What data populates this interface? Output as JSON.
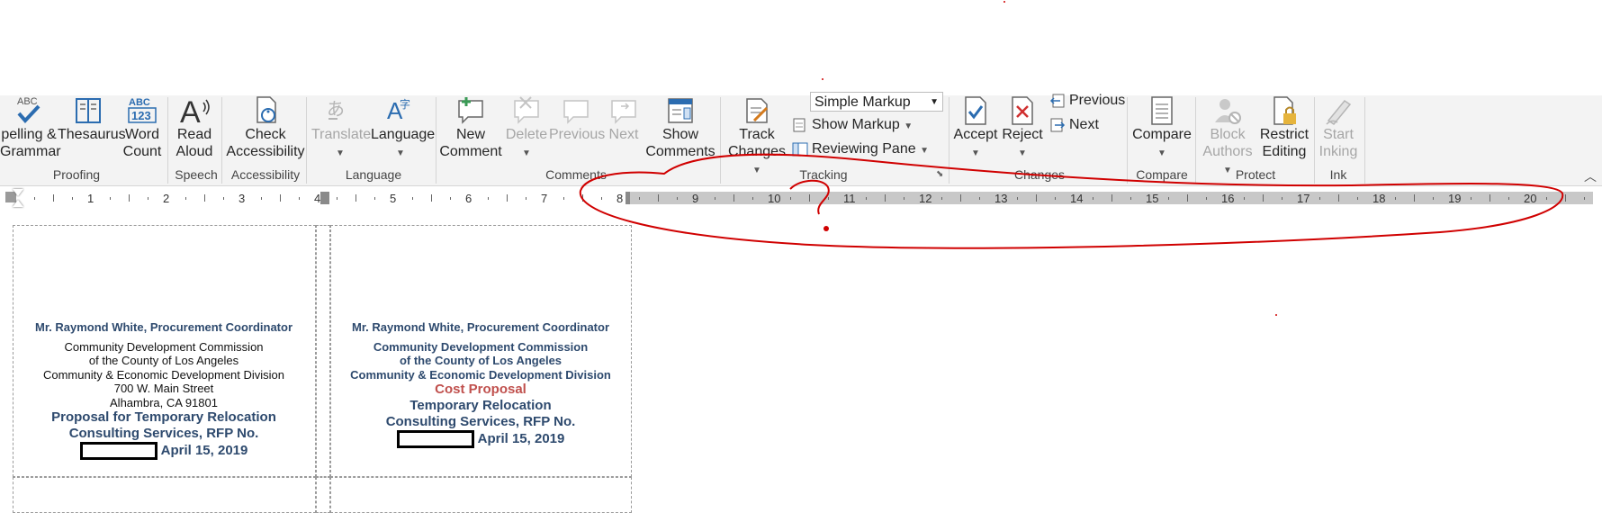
{
  "ribbon": {
    "proofing": {
      "spelling": [
        "pelling &",
        "Grammar"
      ],
      "thesaurus": "Thesaurus",
      "word_count": [
        "Word",
        "Count"
      ],
      "icon_abc": "ABC",
      "icon_123": "123",
      "group": "Proofing"
    },
    "speech": {
      "read_aloud": [
        "Read",
        "Aloud"
      ],
      "group": "Speech"
    },
    "accessibility": {
      "check": [
        "Check",
        "Accessibility"
      ],
      "group": "Accessibility"
    },
    "language": {
      "translate": "Translate",
      "language": "Language",
      "group": "Language"
    },
    "comments": {
      "new_comment": [
        "New",
        "Comment"
      ],
      "delete": "Delete",
      "previous": "Previous",
      "next": "Next",
      "show_comments": [
        "Show",
        "Comments"
      ],
      "group": "Comments"
    },
    "tracking": {
      "track_changes": [
        "Track",
        "Changes"
      ],
      "markup_select": "Simple Markup",
      "show_markup": "Show Markup",
      "reviewing_pane": "Reviewing Pane",
      "group": "Tracking"
    },
    "changes": {
      "accept": "Accept",
      "reject": "Reject",
      "previous": "Previous",
      "next": "Next",
      "group": "Changes"
    },
    "compare": {
      "compare": "Compare",
      "group": "Compare"
    },
    "protect": {
      "block_authors": [
        "Block",
        "Authors"
      ],
      "restrict_editing": [
        "Restrict",
        "Editing"
      ],
      "group": "Protect"
    },
    "ink": {
      "start_inking": [
        "Start",
        "Inking"
      ],
      "group": "Ink"
    }
  },
  "ruler": {
    "numbers": [
      "1",
      "2",
      "3",
      "4",
      "5",
      "6",
      "7",
      "8",
      "9",
      "10",
      "11",
      "12",
      "13",
      "14",
      "15",
      "16",
      "17",
      "18",
      "19",
      "20"
    ]
  },
  "labels": [
    {
      "lines": [
        {
          "text": "Mr. Raymond White, Procurement Coordinator",
          "style": "hdr"
        },
        {
          "text": "Community Development Commission",
          "style": "plain"
        },
        {
          "text": "of the County of Los Angeles",
          "style": "plain"
        },
        {
          "text": "Community & Economic Development Division",
          "style": "plain"
        },
        {
          "text": "700 W. Main Street",
          "style": "plain"
        },
        {
          "text": "Alhambra, CA 91801",
          "style": "plain"
        },
        {
          "text": "Proposal for Temporary Relocation",
          "style": "bluebig"
        },
        {
          "text": "Consulting Services, RFP No.",
          "style": "bluebig"
        }
      ],
      "date": "April 15, 2019"
    },
    {
      "lines": [
        {
          "text": "Mr. Raymond White, Procurement Coordinator",
          "style": "hdr"
        },
        {
          "text": "Community Development Commission",
          "style": "blue"
        },
        {
          "text": "of the County of Los Angeles",
          "style": "blue"
        },
        {
          "text": "Community & Economic Development Division",
          "style": "blue"
        },
        {
          "text": "Cost Proposal",
          "style": "red"
        },
        {
          "text": "Temporary Relocation",
          "style": "bluebig"
        },
        {
          "text": "Consulting Services, RFP No.",
          "style": "bluebig"
        }
      ],
      "date": "April 15, 2019"
    }
  ],
  "colors": {
    "annotation": "#d00000",
    "label_blue": "#2e4a6e",
    "label_red": "#c0504d"
  }
}
